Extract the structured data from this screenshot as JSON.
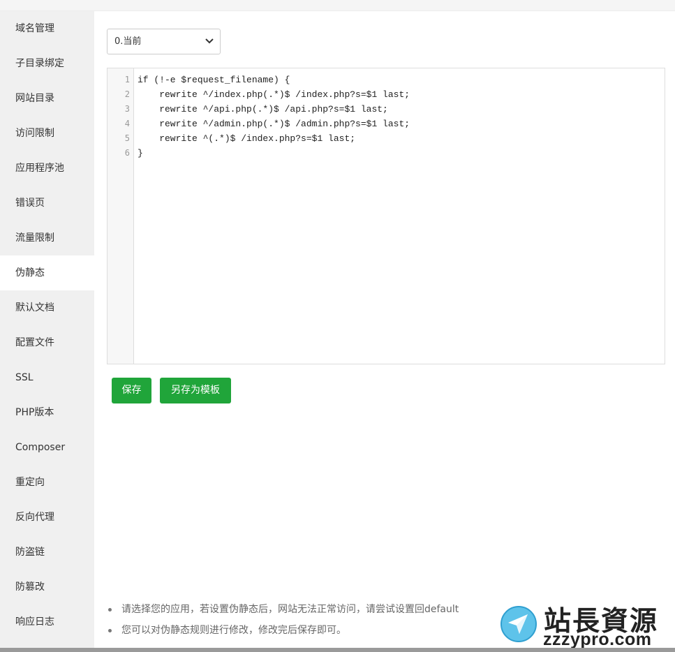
{
  "sidebar": {
    "items": [
      {
        "label": "域名管理"
      },
      {
        "label": "子目录绑定"
      },
      {
        "label": "网站目录"
      },
      {
        "label": "访问限制"
      },
      {
        "label": "应用程序池"
      },
      {
        "label": "错误页"
      },
      {
        "label": "流量限制"
      },
      {
        "label": "伪静态",
        "active": true
      },
      {
        "label": "默认文档"
      },
      {
        "label": "配置文件"
      },
      {
        "label": "SSL"
      },
      {
        "label": "PHP版本"
      },
      {
        "label": "Composer"
      },
      {
        "label": "重定向"
      },
      {
        "label": "反向代理"
      },
      {
        "label": "防盗链"
      },
      {
        "label": "防篡改"
      },
      {
        "label": "响应日志"
      }
    ]
  },
  "rewrite": {
    "selected": "0.当前",
    "chevron_icon": "chevron-down-icon"
  },
  "editor": {
    "line_numbers": [
      "1",
      "2",
      "3",
      "4",
      "5",
      "6"
    ],
    "lines": [
      "if (!-e $request_filename) {",
      "    rewrite ^/index.php(.*)$ /index.php?s=$1 last;",
      "    rewrite ^/api.php(.*)$ /api.php?s=$1 last;",
      "    rewrite ^/admin.php(.*)$ /admin.php?s=$1 last;",
      "    rewrite ^(.*)$ /index.php?s=$1 last;",
      "}"
    ]
  },
  "buttons": {
    "save": "保存",
    "save_as_template": "另存为模板"
  },
  "tips": [
    "请选择您的应用，若设置伪静态后，网站无法正常访问，请尝试设置回default",
    "您可以对伪静态规则进行修改，修改完后保存即可。"
  ],
  "watermark": {
    "cn": "站長資源",
    "en": "zzzypro.com"
  },
  "colors": {
    "accent": "#20a53a",
    "sidebar_bg": "#f0f0f0"
  }
}
